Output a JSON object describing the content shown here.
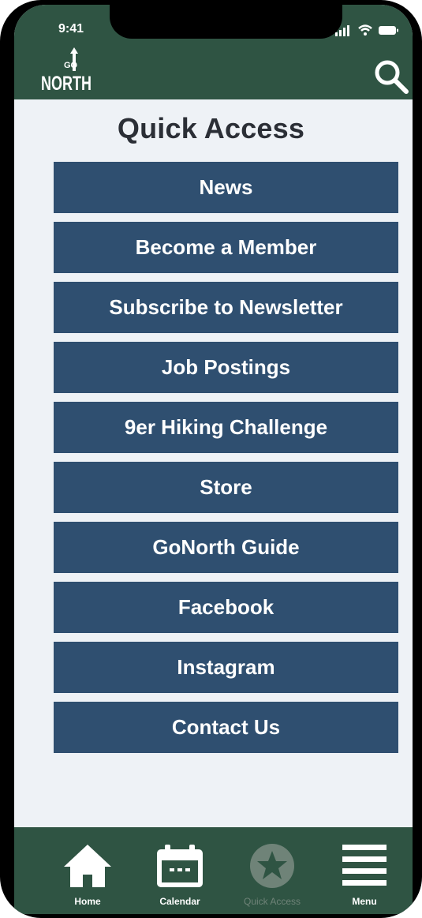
{
  "status_bar": {
    "time": "9:41"
  },
  "header": {
    "logo_small": "GO",
    "logo_main": "NORTH",
    "search_icon": "search-icon"
  },
  "page": {
    "title": "Quick Access"
  },
  "quick_links": [
    {
      "label": "News"
    },
    {
      "label": "Become a Member"
    },
    {
      "label": "Subscribe to Newsletter"
    },
    {
      "label": "Job Postings"
    },
    {
      "label": "9er Hiking Challenge"
    },
    {
      "label": "Store"
    },
    {
      "label": "GoNorth Guide"
    },
    {
      "label": "Facebook"
    },
    {
      "label": "Instagram"
    },
    {
      "label": "Contact Us"
    }
  ],
  "tabbar": {
    "items": [
      {
        "label": "Home",
        "icon": "home-icon",
        "active": true
      },
      {
        "label": "Calendar",
        "icon": "calendar-icon",
        "active": true
      },
      {
        "label": "Quick Access",
        "icon": "star-icon",
        "active": false
      },
      {
        "label": "Menu",
        "icon": "menu-icon",
        "active": true
      }
    ]
  },
  "colors": {
    "header_green": "#2f5443",
    "button_blue": "#2f4f70",
    "background": "#eef2f6",
    "title_text": "#2b2f36"
  }
}
